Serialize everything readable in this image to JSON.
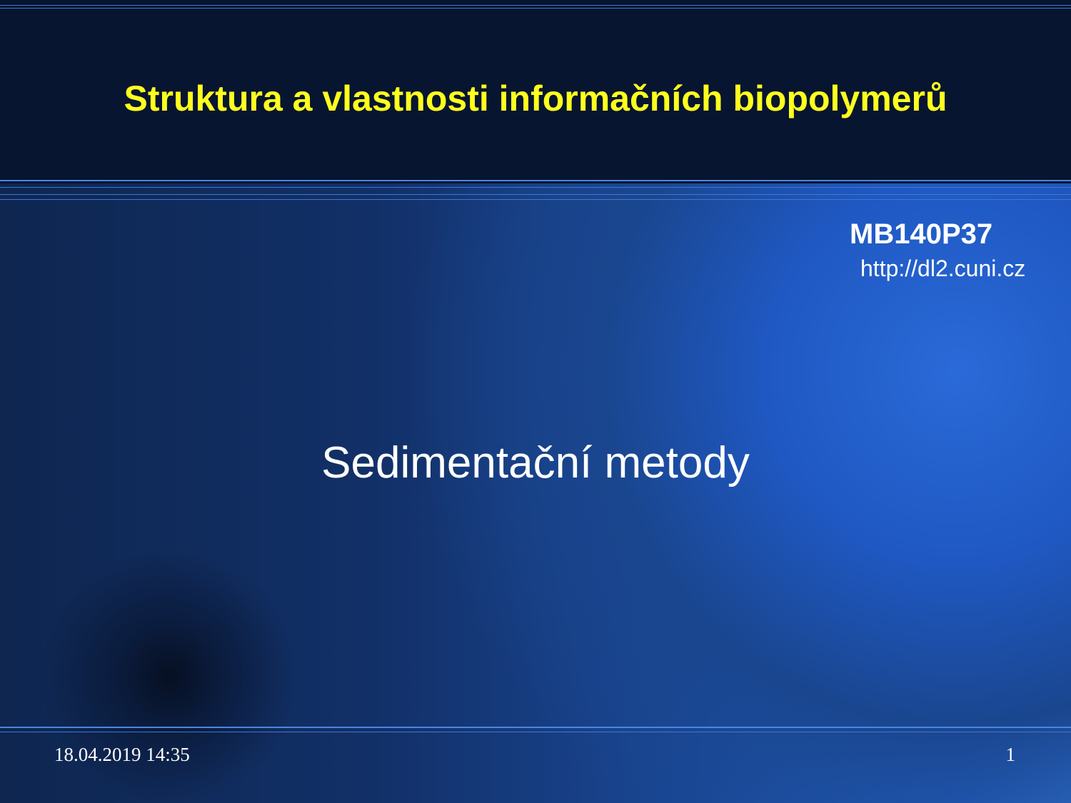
{
  "slide": {
    "title": "Struktura a vlastnosti informačních biopolymerů",
    "course_code": "MB140P37",
    "course_url": "http://dl2.cuni.cz",
    "subtitle": "Sedimentační metody",
    "footer_date": "18.04.2019 14:35",
    "page_number": "1"
  },
  "colors": {
    "header_background": "#071530",
    "title": "#ffff1e",
    "text": "#ffffff",
    "accent_lines": "#3f78d0"
  }
}
